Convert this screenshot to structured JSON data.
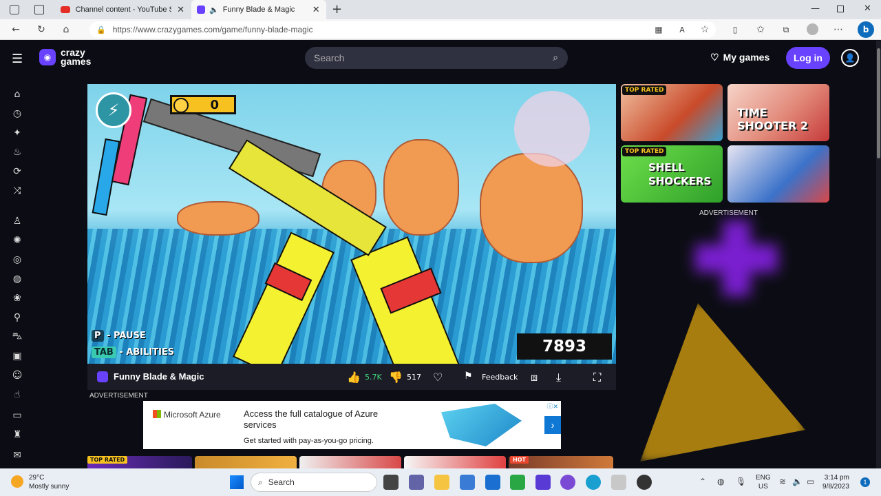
{
  "browser": {
    "tabs": [
      {
        "title": "Channel content - YouTube Stud",
        "active": false
      },
      {
        "title": "Funny Blade & Magic",
        "active": true
      }
    ],
    "url": "https://www.crazygames.com/game/funny-blade-magic"
  },
  "header": {
    "logo_line1": "crazy",
    "logo_line2": "games",
    "search_placeholder": "Search",
    "my_games": "My games",
    "login": "Log in"
  },
  "game": {
    "coins": "0",
    "hint_pause_key": "P",
    "hint_pause": "- PAUSE",
    "hint_abilities_key": "TAB",
    "hint_abilities": "- ABILITIES",
    "score": "7893"
  },
  "game_bar": {
    "title": "Funny Blade & Magic",
    "likes": "5.7K",
    "dislikes": "517",
    "feedback": "Feedback"
  },
  "ads": {
    "label_left": "ADVERTISEMENT",
    "label_right": "ADVERTISEMENT",
    "brand": "Microsoft Azure",
    "headline": "Access the full catalogue of Azure services",
    "sub": "Get started with pay-as-you-go pricing."
  },
  "recommended": [
    {
      "badge": "TOP RATED",
      "title": "",
      "color": "#c94a2a"
    },
    {
      "badge": "",
      "title": "TIME SHOOTER 2",
      "color": "#e28a7a"
    },
    {
      "badge": "TOP RATED",
      "title": "SHELL SHOCKERS",
      "color": "#4fcb35"
    },
    {
      "badge": "",
      "title": "",
      "color": "#3b72c9"
    }
  ],
  "bottom_strip": {
    "badge_top_rated": "TOP RATED",
    "badge_hot": "HOT"
  },
  "taskbar": {
    "temperature": "29°C",
    "weather": "Mostly sunny",
    "search": "Search",
    "lang1": "ENG",
    "lang2": "US",
    "time": "3:14 pm",
    "date": "9/8/2023",
    "notifications": "1"
  },
  "colors": {
    "brand": "#6842ff",
    "background": "#0c0d14",
    "like_green": "#3fd67a"
  }
}
